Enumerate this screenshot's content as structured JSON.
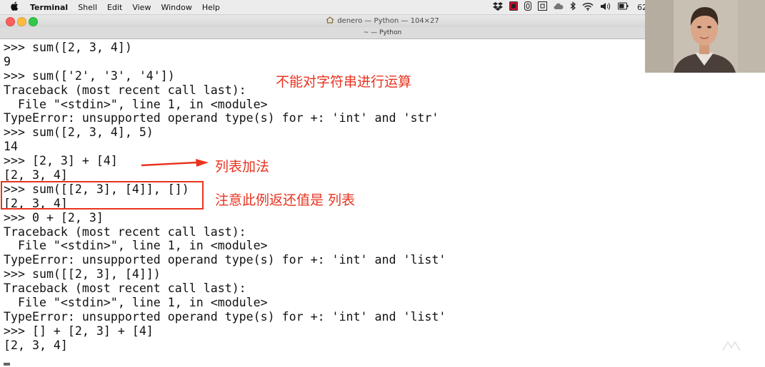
{
  "menubar": {
    "app_name": "Terminal",
    "items": [
      "Shell",
      "Edit",
      "View",
      "Window",
      "Help"
    ],
    "status_icons": [
      "dropbox-icon",
      "record-icon",
      "zero-icon",
      "grid-icon",
      "cloud-icon",
      "bluetooth-icon",
      "wifi-icon",
      "volume-icon",
      "battery-icon"
    ],
    "battery_text": "62"
  },
  "window": {
    "title": "denero — Python — 104×27",
    "tab_label": "~ — Python"
  },
  "terminal": {
    "lines": [
      ">>> sum([2, 3, 4])",
      "9",
      ">>> sum(['2', '3', '4'])",
      "Traceback (most recent call last):",
      "  File \"<stdin>\", line 1, in <module>",
      "TypeError: unsupported operand type(s) for +: 'int' and 'str'",
      ">>> sum([2, 3, 4], 5)",
      "14",
      ">>> [2, 3] + [4]",
      "[2, 3, 4]",
      ">>> sum([[2, 3], [4]], [])",
      "[2, 3, 4]",
      ">>> 0 + [2, 3]",
      "Traceback (most recent call last):",
      "  File \"<stdin>\", line 1, in <module>",
      "TypeError: unsupported operand type(s) for +: 'int' and 'list'",
      ">>> sum([[2, 3], [4]])",
      "Traceback (most recent call last):",
      "  File \"<stdin>\", line 1, in <module>",
      "TypeError: unsupported operand type(s) for +: 'int' and 'list'",
      ">>> [] + [2, 3] + [4]",
      "[2, 3, 4]"
    ]
  },
  "annotations": {
    "string_note": "不能对字符串进行运算",
    "list_add_note": "列表加法",
    "return_list_note": "注意此例返还值是 列表",
    "color": "#e8331f"
  }
}
